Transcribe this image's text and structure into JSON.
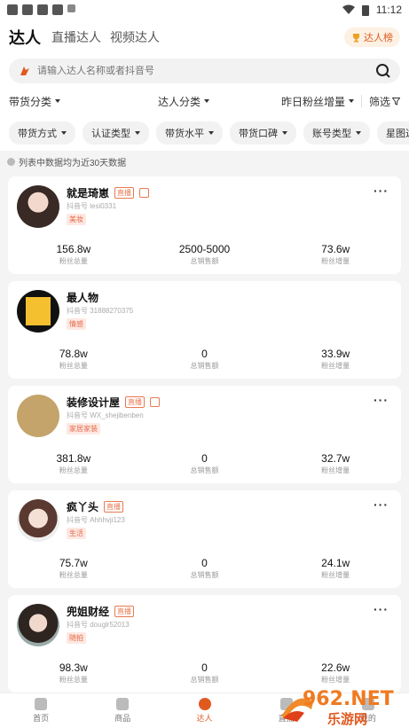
{
  "status_bar": {
    "time": "11:12"
  },
  "header": {
    "tabs": [
      "达人",
      "直播达人",
      "视频达人"
    ],
    "rank_button": "达人榜"
  },
  "search": {
    "placeholder": "请输入达人名称或者抖音号"
  },
  "filters": {
    "goods_category": "带货分类",
    "creator_category": "达人分类",
    "fans_growth": "昨日粉丝增量",
    "screen": "筛选"
  },
  "chips": [
    "带货方式",
    "认证类型",
    "带货水平",
    "带货口碑",
    "账号类型",
    "星图达人"
  ],
  "notice": "列表中数据均为近30天数据",
  "creators": [
    {
      "name": "就是琦崽",
      "douyin_id": "抖音号 lesi0331",
      "tag": "美妆",
      "fans_total": "156.8w",
      "sales": "2500-5000",
      "fans_growth": "73.6w",
      "live": true,
      "shop": true
    },
    {
      "name": "最人物",
      "douyin_id": "抖音号 31888270375",
      "tag": "情感",
      "fans_total": "78.8w",
      "sales": "0",
      "fans_growth": "33.9w",
      "live": false,
      "shop": false
    },
    {
      "name": "装修设计屋",
      "douyin_id": "抖音号 WX_shejibenben",
      "tag": "家居家装",
      "fans_total": "381.8w",
      "sales": "0",
      "fans_growth": "32.7w",
      "live": true,
      "shop": true
    },
    {
      "name": "疯丫头",
      "douyin_id": "抖音号 Ahhhvji123",
      "tag": "生活",
      "fans_total": "75.7w",
      "sales": "0",
      "fans_growth": "24.1w",
      "live": true,
      "shop": false
    },
    {
      "name": "兜姐财经",
      "douyin_id": "抖音号 douglr52013",
      "tag": "随拍",
      "fans_total": "98.3w",
      "sales": "0",
      "fans_growth": "22.6w",
      "live": true,
      "shop": false
    }
  ],
  "stat_labels": {
    "fans_total": "粉丝总量",
    "sales": "总销售额",
    "fans_growth": "粉丝增量"
  },
  "live_badge": "直播",
  "more_glyph": "···",
  "bottom_nav": [
    {
      "label": "首页",
      "active": false
    },
    {
      "label": "商品",
      "active": false
    },
    {
      "label": "达人",
      "active": true
    },
    {
      "label": "直播",
      "active": false
    },
    {
      "label": "我的",
      "active": false
    }
  ],
  "watermark": {
    "site": "962.NET",
    "name": "乐游网"
  },
  "colors": {
    "accent": "#e05a20",
    "tag_bg": "#fde8e2"
  }
}
